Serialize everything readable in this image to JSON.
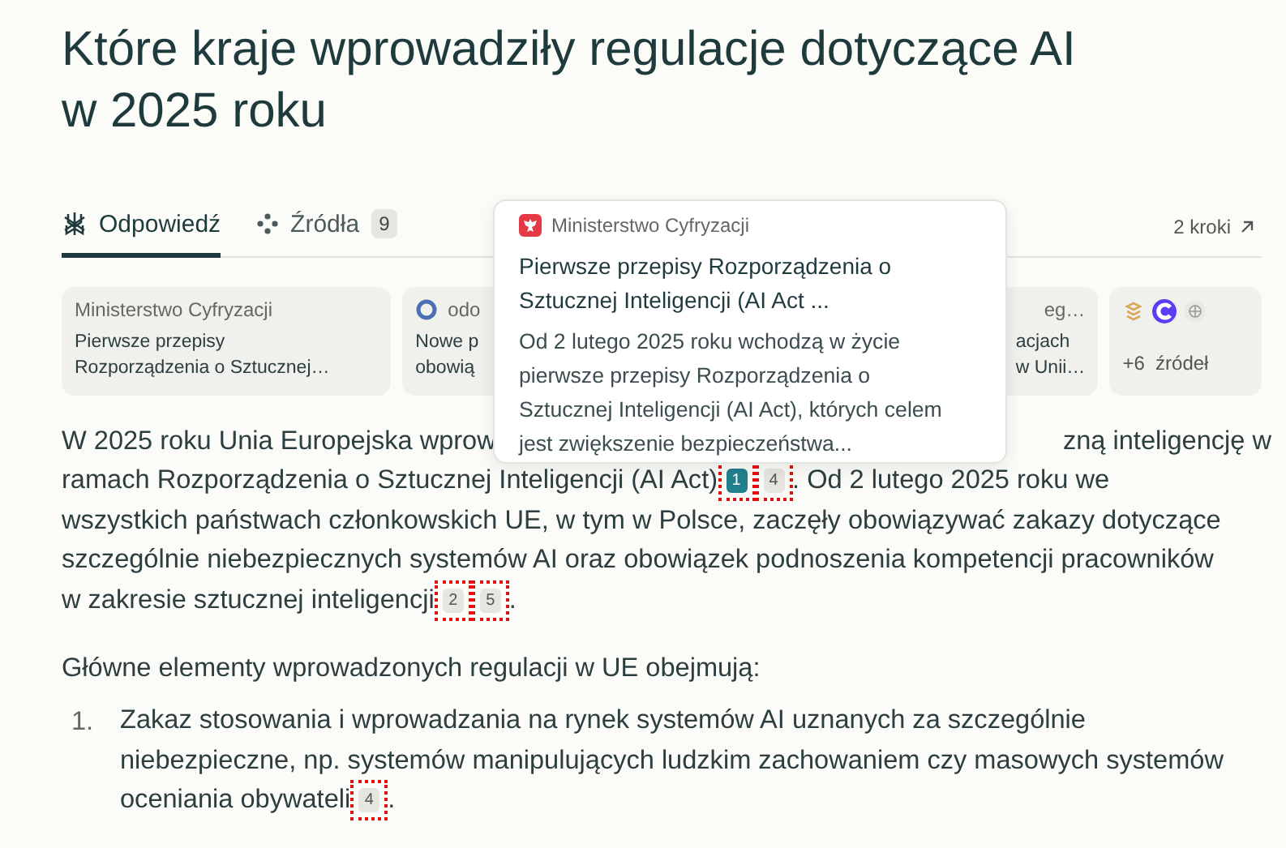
{
  "title": "Które kraje wprowadziły regulacje dotyczące AI w 2025 roku",
  "tabs": [
    {
      "label": "Odpowiedź",
      "kind": "answer",
      "selected": true
    },
    {
      "label": "Źródła",
      "kind": "sources",
      "count": "9",
      "selected": false
    }
  ],
  "steps_link": "2 kroki",
  "source_cards": [
    {
      "kind": "gov",
      "source": "Ministerstwo Cyfryzacji",
      "title_lines": [
        "Pierwsze przepisy",
        "Rozporządzenia o Sztucznej…"
      ]
    },
    {
      "kind": "ring",
      "source": "odo",
      "title_lines": [
        "Nowe p",
        "obowią"
      ]
    },
    {
      "kind": "hidden",
      "source": "eg…",
      "title_lines": [
        "acjach",
        "w Unii…"
      ]
    },
    {
      "kind": "more",
      "more_label": "+6  źródeł"
    }
  ],
  "popup": {
    "source": "Ministerstwo Cyfryzacji",
    "title": "Pierwsze przepisy Rozporządzenia o Sztucznej Inteligencji (AI Act ...",
    "snippet": "Od 2 lutego 2025 roku wchodzą w życie pierwsze przepisy Rozporządzenia o Sztucznej Inteligencji (AI Act), których celem jest zwiększenie bezpieczeństwa..."
  },
  "paragraph_lines": [
    [
      {
        "kind": "text",
        "text": "W 2025 roku Unia Europejska wprow"
      },
      {
        "kind": "text",
        "text": "zną inteligencję w"
      }
    ],
    [
      {
        "kind": "text",
        "text": "ramach Rozporządzenia o Sztucznej Inteligencji (AI Act)"
      },
      {
        "kind": "cite",
        "number": "1",
        "active": true,
        "highlighted": true
      },
      {
        "kind": "cite",
        "number": "4",
        "active": false,
        "highlighted": true
      },
      {
        "kind": "text",
        "text": ". Od 2 lutego 2025 roku we"
      }
    ],
    [
      {
        "kind": "text",
        "text": "wszystkich państwach członkowskich UE, w tym w Polsce, zaczęły obowiązywać zakazy dotyczące"
      }
    ],
    [
      {
        "kind": "text",
        "text": "szczególnie niebezpiecznych systemów AI oraz obowiązek podnoszenia kompetencji pracowników"
      }
    ],
    [
      {
        "kind": "text",
        "text": "w zakresie sztucznej inteligencji"
      },
      {
        "kind": "cite",
        "number": "2",
        "active": false,
        "highlighted": true
      },
      {
        "kind": "cite",
        "number": "5",
        "active": false,
        "highlighted": true
      },
      {
        "kind": "text",
        "text": "."
      }
    ]
  ],
  "list_intro": "Główne elementy wprowadzonych regulacji w UE obejmują:",
  "list_items": [
    {
      "marker": "1.",
      "lines": [
        [
          {
            "kind": "text",
            "text": "Zakaz stosowania i wprowadzania na rynek systemów AI uznanych za szczególnie"
          }
        ],
        [
          {
            "kind": "text",
            "text": "niebezpieczne, np. systemów manipulujących ludzkim zachowaniem czy masowych systemów"
          }
        ],
        [
          {
            "kind": "text",
            "text": "oceniania obywateli"
          },
          {
            "kind": "cite",
            "number": "4",
            "active": false,
            "highlighted": true
          },
          {
            "kind": "text",
            "text": "."
          }
        ]
      ]
    }
  ]
}
